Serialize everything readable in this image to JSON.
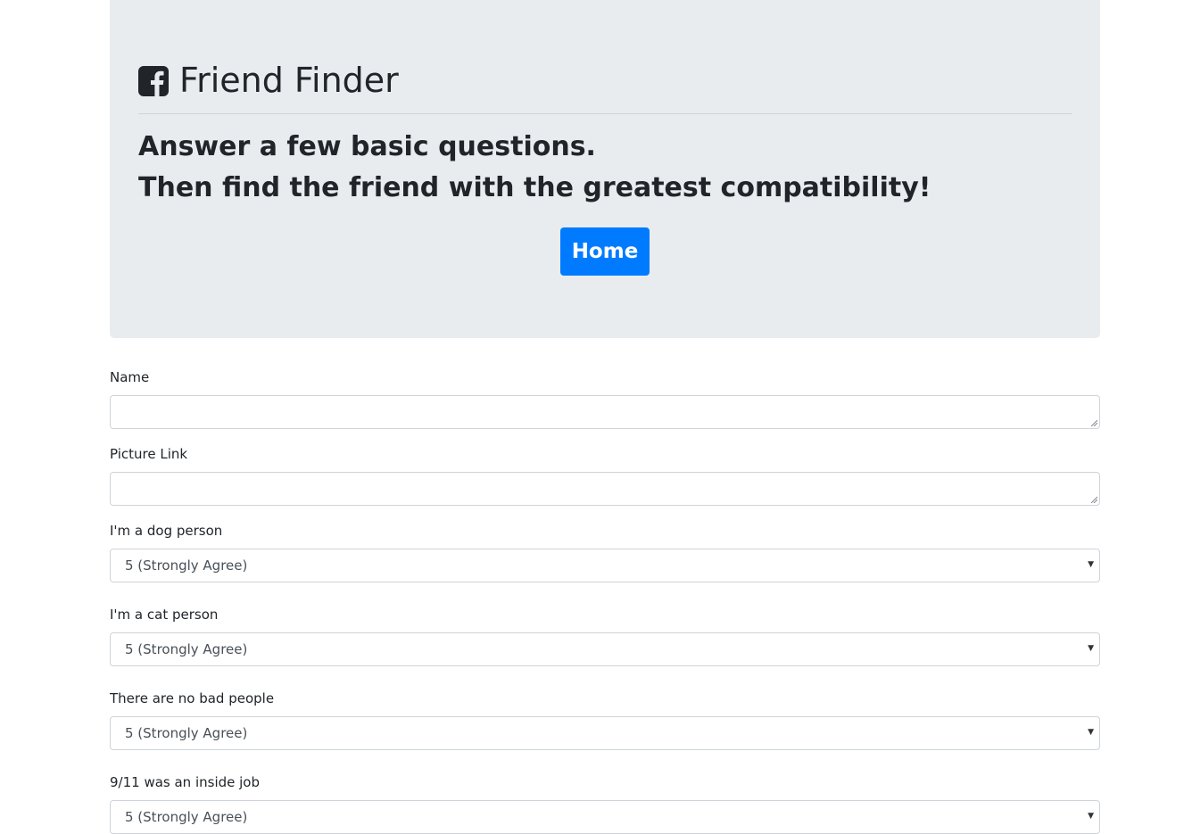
{
  "header": {
    "title": "Friend Finder",
    "icon": "facebook-square-icon",
    "lead_line1": "Answer a few basic questions.",
    "lead_line2": "Then find the friend with the greatest compatibility!",
    "home_button": "Home"
  },
  "form": {
    "name_label": "Name",
    "name_value": "",
    "picture_label": "Picture Link",
    "picture_value": "",
    "questions": [
      {
        "label": "I'm a dog person",
        "selected": "5 (Strongly Agree)"
      },
      {
        "label": "I'm a cat person",
        "selected": "5 (Strongly Agree)"
      },
      {
        "label": "There are no bad people",
        "selected": "5 (Strongly Agree)"
      },
      {
        "label": "9/11 was an inside job",
        "selected": "5 (Strongly Agree)"
      }
    ]
  },
  "colors": {
    "jumbotron_bg": "#e9ecef",
    "primary": "#007bff",
    "border": "#ced4da"
  }
}
